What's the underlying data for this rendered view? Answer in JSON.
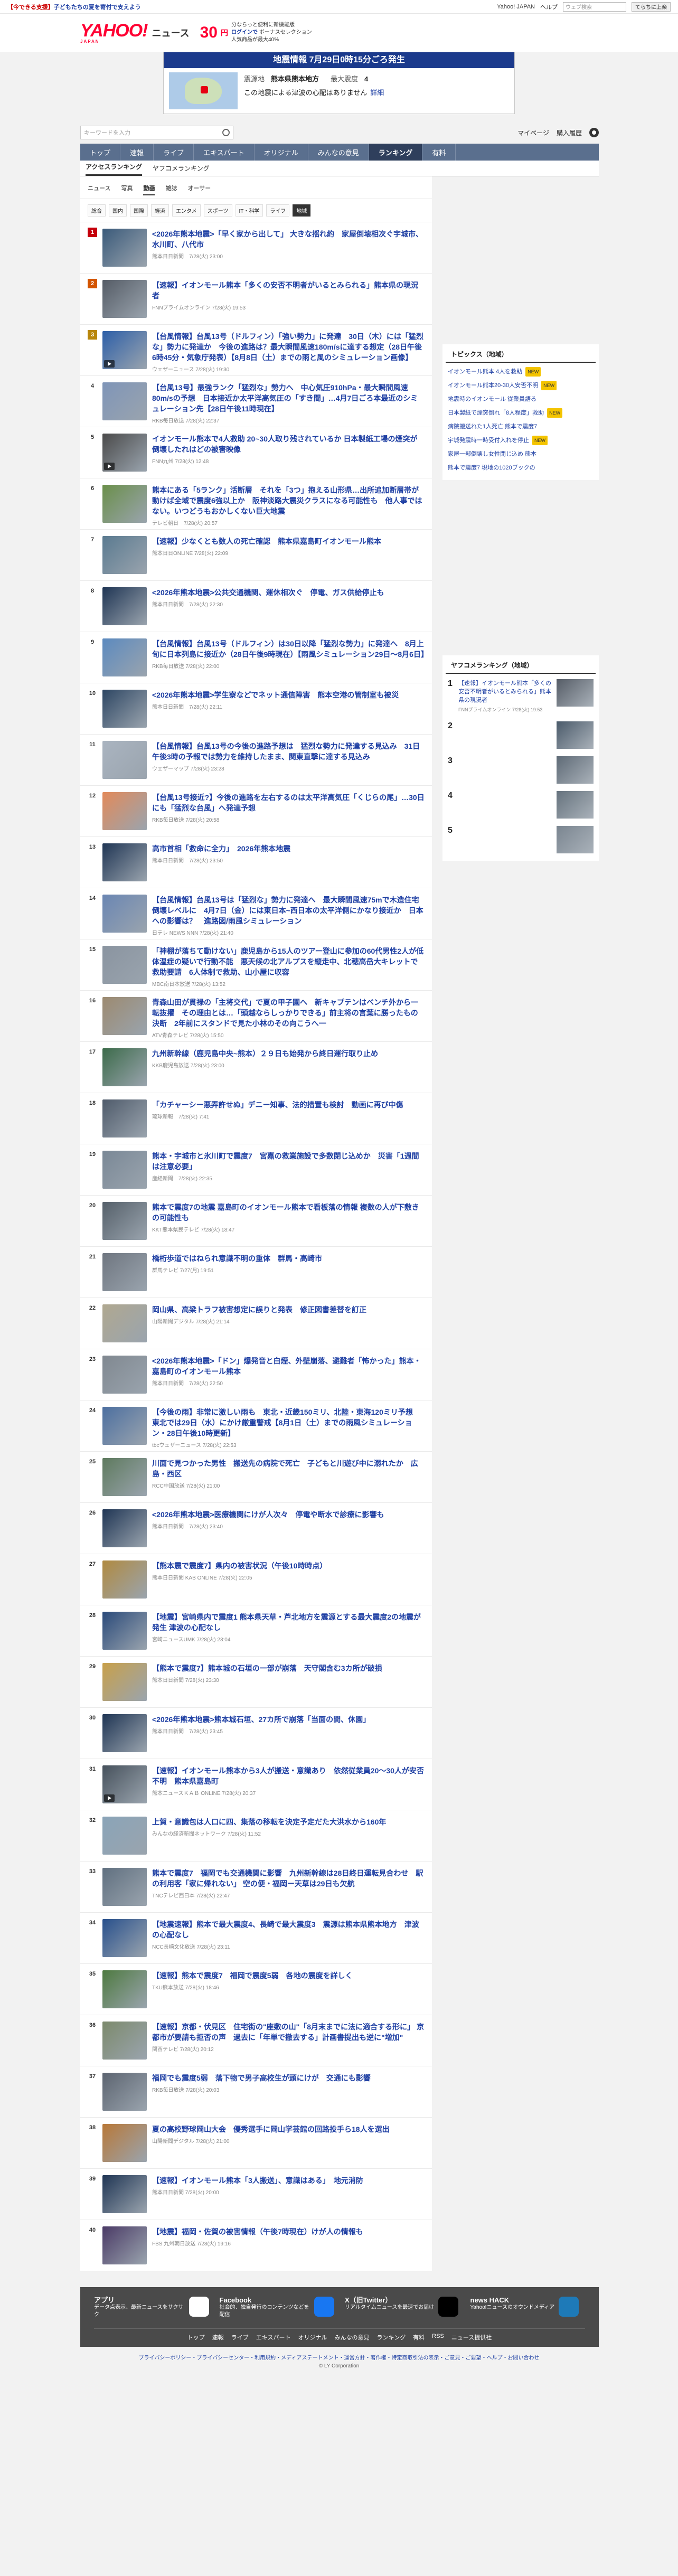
{
  "topbar": {
    "promo_prefix": "【今できる支援】",
    "promo_text": "子どもたちの夏を寄付で支えよう",
    "right_links": [
      "Yahoo! JAPAN",
      "ヘルプ"
    ],
    "search_placeholder": "ウェブ検索",
    "search_button": "てらちに上楽"
  },
  "header": {
    "logo": "YAHOO!",
    "logo_sub": "JAPAN",
    "service": "ニュース",
    "points": "30",
    "points_unit": "円",
    "points_text1": "分ならっと便利に新機能版",
    "points_text2": "ログインで",
    "points_text3": "ボーナスセレクション",
    "points_text4": "人気商品が最大40%"
  },
  "alert": {
    "title": "地震情報 7月29日0時15分ごろ発生",
    "epicenter_label": "震源地",
    "epicenter": "熊本県熊本地方",
    "intensity_label": "最大震度",
    "intensity": "4",
    "note": "この地震による津波の心配はありません",
    "detail": "詳細"
  },
  "search": {
    "placeholder": "キーワードを入力",
    "mypage": "マイページ",
    "register": "購入履歴"
  },
  "nav": {
    "tabs": [
      "トップ",
      "速報",
      "ライブ",
      "エキスパート",
      "オリジナル",
      "みんなの意見",
      "ランキング",
      "有料"
    ],
    "active": 6
  },
  "subtabs": {
    "items": [
      "アクセスランキング",
      "ヤフコメランキング"
    ],
    "active": 0
  },
  "cat1": {
    "items": [
      "ニュース",
      "写真",
      "動画",
      "雑誌",
      "オーサー"
    ],
    "active": 2
  },
  "cat2": {
    "items": [
      "総合",
      "国内",
      "国際",
      "経済",
      "エンタメ",
      "スポーツ",
      "IT・科学",
      "ライフ",
      "地域"
    ],
    "active": 8
  },
  "ranking": [
    {
      "num": "1",
      "title": "<2026年熊本地震>「早く家から出して」 大きな揺れ約　家屋倒壊相次ぐ宇城市、水川町、八代市",
      "meta": "熊本日日新聞　7/28(火) 23:00",
      "thumb": "#3a5a7a"
    },
    {
      "num": "2",
      "title": "【速報】イオンモール熊本「多くの安否不明者がいるとみられる」熊本県の現況者",
      "meta": "FNNプライムオンライン 7/28(火) 19:53",
      "thumb": "#555c66"
    },
    {
      "num": "3",
      "title": "【台風情報】台風13号（ドルフィン）「強い勢力」に発達　30日（木）には「猛烈な」勢力に発達か　今後の進路は？最大瞬間風速180m/sに達する想定（28日午後6時45分・気象庁発表）【8月8日（土）までの雨と風のシミュレーション画像】",
      "meta": "ウェザーニュース 7/28(火) 19:30",
      "thumb": "#2d5fa8",
      "vid": true
    },
    {
      "num": "4",
      "title": "【台風13号】最強ランク「猛烈な」勢力へ　中心気圧910hPa・最大瞬間風速80m/sの予想　日本接近か太平洋高気圧の「すき間」…4月7日ごろ本最近のシミュレーション先【28日午後11時現在】",
      "meta": "RKB毎日放送 7/28(火) 22:37",
      "thumb": "#7f95b8"
    },
    {
      "num": "5",
      "title": "イオンモール熊本で4人救助 20~30人取り残されているか 日本製紙工場の煙突が倒壊したれはどの被害映像",
      "meta": "FNN九州 7/28(火) 12:48",
      "thumb": "#4a4a4a",
      "vid": true
    },
    {
      "num": "6",
      "title": "熊本にある「5ランク」活断層　それを「3つ」抱える山形県…出所追加断層帯が動けば全域で震度6強以上か　阪神淡路大震災クラスになる可能性も　他人事ではない。いつどうもおかしくない巨大地震",
      "meta": "テレビ朝日　7/28(火) 20:57",
      "thumb": "#6a8f4a"
    },
    {
      "num": "7",
      "title": "【速報】少なくとも数人の死亡確認　熊本県嘉島町イオンモール熊本",
      "meta": "熊本日日ONLINE 7/28(火) 22:09",
      "thumb": "#5a7a90"
    },
    {
      "num": "8",
      "title": "<2026年熊本地震>公共交通機関、運休相次ぐ　停電、ガス供給停止も",
      "meta": "熊本日日新聞　7/28(火) 22:30",
      "thumb": "#1f3554"
    },
    {
      "num": "9",
      "title": "【台風情報】台風13号（ドルフィン）は30日以降「猛烈な勢力」に発達へ　8月上旬に日本列島に接近か（28日午後9時現在）【雨風シミュレーション29日～8月6日】",
      "meta": "RKB毎日放送 7/28(火) 22:00",
      "thumb": "#5c8abf"
    },
    {
      "num": "10",
      "title": "<2026年熊本地震>学生寮などでネット通信障害　熊本空港の管制室も被災",
      "meta": "熊本日日新聞　7/28(火) 22:11",
      "thumb": "#2d4663"
    },
    {
      "num": "11",
      "title": "【台風情報】台風13号の今後の進路予想は　猛烈な勢力に発達する見込み　31日午後3時の予報では勢力を維持したまま、関東直撃に達する見込み",
      "meta": "ウェザーマップ 7/28(火) 23:28",
      "thumb": "#aab4c0"
    },
    {
      "num": "12",
      "title": "【台風13号接近?】今後の進路を左右するのは太平洋高気圧「くじらの尾」…30日にも「猛烈な台風」へ発達予想",
      "meta": "RKB毎日放送 7/28(火) 20:58",
      "thumb": "#e28a5a"
    },
    {
      "num": "13",
      "title": "高市首相「救命に全力」　2026年熊本地震",
      "meta": "熊本日日新聞　7/28(火) 23:50",
      "thumb": "#1f3554"
    },
    {
      "num": "14",
      "title": "【台風情報】台風13号は「猛烈な」勢力に発達へ　最大瞬間風速75mで木造住宅倒壊レベルに　4月7日（金）には東日本~西日本の太平洋側にかなり接近か　日本への影響は？　進路図/雨風シミュレーション",
      "meta": "日テレ NEWS NNN 7/28(火) 21:40",
      "thumb": "#6a86b3"
    },
    {
      "num": "15",
      "title": "「神棚が落ちて動けない」鹿児島から15人のツアー登山に参加の60代男性2人が低体温症の疑いで行動不能　悪天候の北アルプスを縦走中、北穂高岳大キレットで救助要請　6人体制で救助、山小屋に収容",
      "meta": "MBC南日本放送 7/28(火) 13:52",
      "thumb": "#8a94a0"
    },
    {
      "num": "16",
      "title": "青森山田が貫禄の「主将交代」で夏の甲子園へ　新キャプテンはベンチ外から一転抜擢　その理由とは…「頭越ならしっかりできる」前主将の言葉に勝ったもの決断　2年前にスタンドで見た小林のその向こうへ一",
      "meta": "ATV青森テレビ 7/28(火) 15:50",
      "thumb": "#9c8a70"
    },
    {
      "num": "17",
      "title": "九州新幹線（鹿児島中央~熊本）２９日も始発から終日運行取り止め",
      "meta": "KKB鹿児島放送 7/28(火) 23:00",
      "thumb": "#3c6b4a"
    },
    {
      "num": "18",
      "title": "「カチャーシー悪弄許せぬ」デニー知事、法的措置も検討　動画に再び中傷",
      "meta": "琉球新報　7/28(火) 7:41",
      "thumb": "#4f5b6b"
    },
    {
      "num": "19",
      "title": "熊本・宇城市と氷川町で震度7　宮嘉の救業施設で多数閉じ込めか　災害「1週間は注意必要」",
      "meta": "産経新聞　7/28(火) 22:35",
      "thumb": "#7a8896"
    },
    {
      "num": "20",
      "title": "熊本で震度7の地震 嘉島町のイオンモール熊本で看板落の情報 複数の人が下敷きの可能性も",
      "meta": "KKT熊本県民テレビ 7/28(火) 18:47",
      "thumb": "#55606a"
    },
    {
      "num": "21",
      "title": "橋桁歩道ではねられ意識不明の重体　群馬・高崎市",
      "meta": "群馬テレビ 7/27(月) 19:51",
      "thumb": "#6f7680"
    },
    {
      "num": "22",
      "title": "岡山県、高梁トラフ被害想定に誤りと発表　修正図書差替を訂正",
      "meta": "山陽新聞デジタル 7/28(火) 21:14",
      "thumb": "#b0a890"
    },
    {
      "num": "23",
      "title": "<2026年熊本地震>「ドン」爆発音と白煙、外壁崩落、避難者「怖かった」熊本・嘉島町のイオンモール熊本",
      "meta": "熊本日日新聞　7/28(火) 22:50",
      "thumb": "#808890"
    },
    {
      "num": "24",
      "title": "【今後の雨】非常に激しい雨も　東北・近畿150ミリ、北陸・東海120ミリ予想　東北では29日（水）にかけ厳重警戒【8月1日（土）までの雨風シミュレーション・28日午後10時更新】",
      "meta": "tbcウェザーニュース 7/28(火) 22:53",
      "thumb": "#4c6fa0"
    },
    {
      "num": "25",
      "title": "川面で見つかった男性　搬送先の病院で死亡　子どもと川遊び中に溺れたか　広島・西区",
      "meta": "RCC中国放送 7/28(火) 21:00",
      "thumb": "#5e7a5e"
    },
    {
      "num": "26",
      "title": "<2026年熊本地震>医療機関にけが人次々　停電や断水で診療に影響も",
      "meta": "熊本日日新聞　7/28(火) 23:40",
      "thumb": "#1f3554"
    },
    {
      "num": "27",
      "title": "【熊本震で震度7】県内の被害状況（午後10時時点）",
      "meta": "熊本日日新聞 KAB ONLINE 7/28(火) 22:05",
      "thumb": "#b08a40"
    },
    {
      "num": "28",
      "title": "【地震】宮崎県内で震度1 熊本県天草・芦北地方を震源とする最大震度2の地震が発生 津波の心配なし",
      "meta": "宮崎ニュースUMK 7/28(火) 23:04",
      "thumb": "#2a4a7a"
    },
    {
      "num": "29",
      "title": "【熊本で震度7】熊本城の石垣の一部が崩落　天守閣含む3カ所が破損",
      "meta": "熊本日日新聞 7/28(火) 23:30",
      "thumb": "#c8a04a"
    },
    {
      "num": "30",
      "title": "<2026年熊本地震>熊本城石垣、27カ所で崩落「当面の間、休園」",
      "meta": "熊本日日新聞　7/28(火) 23:45",
      "thumb": "#1f3554"
    },
    {
      "num": "31",
      "title": "【速報】イオンモール熊本から3人が搬送・意識あり　依然従業員20～30人が安否不明　熊本県嘉島町",
      "meta": "熊本ニュースＫＡＢ ONLINE 7/28(火) 20:37",
      "thumb": "#46515c",
      "vid": true
    },
    {
      "num": "32",
      "title": "上賀・意識包は人口に四、集落の移転を決定予定だた大洪水から160年",
      "meta": "みんなの経済新聞ネットワーク 7/28(火) 11:52",
      "thumb": "#8aa4b8"
    },
    {
      "num": "33",
      "title": "熊本で震度7　福岡でも交通機関に影響　九州新幹線は28日終日運転見合わせ　駅の利用客「家に帰れない」 空の便・福岡ー天草は29日も欠航",
      "meta": "TNCテレビ西日本 7/28(火) 22:47",
      "thumb": "#607080"
    },
    {
      "num": "34",
      "title": "【地震速報】熊本で最大震度4、長崎で最大震度3　震源は熊本県熊本地方　津波の心配なし",
      "meta": "NCC長崎文化放送 7/28(火) 23:11",
      "thumb": "#28508c"
    },
    {
      "num": "35",
      "title": "【速報】熊本で震度7　福岡で震度5弱　各地の震度を詳しく",
      "meta": "TKU熊本放送 7/28(火) 18:46",
      "thumb": "#4e7a40"
    },
    {
      "num": "36",
      "title": "【速報】京都・伏見区　住宅街の\"座敷の山\"「8月末までに法に適合する形に」 京都市が要請も拒否の声　過去に「年単で撤去する」計画書提出も逆に\"増加\"",
      "meta": "関西テレビ 7/28(火) 20:12",
      "thumb": "#7c8a6c"
    },
    {
      "num": "37",
      "title": "福岡でも震度5弱　落下物で男子高校生が頭にけが　交通にも影響",
      "meta": "RKB毎日放送 7/28(火) 20:03",
      "thumb": "#5c6470"
    },
    {
      "num": "38",
      "title": "夏の高校野球岡山大会　優秀選手に岡山学芸館の回路投手ら18人を選出",
      "meta": "山陽新聞デジタル 7/28(火) 21:00",
      "thumb": "#b87838"
    },
    {
      "num": "39",
      "title": "【速報】イオンモール熊本「3人搬送」、意識はある」　地元消防",
      "meta": "熊本日日新聞 7/28(火) 20:00",
      "thumb": "#1f3554"
    },
    {
      "num": "40",
      "title": "【地震】福岡・佐賀の被害情報（午後7時現在）けが人の情報も",
      "meta": "FBS 九州朝日放送 7/28(火) 19:16",
      "thumb": "#4a3a66"
    }
  ],
  "topics": {
    "title": "トピックス（地域）",
    "items": [
      {
        "text": "イオンモール熊本 4人を救助",
        "badge": "NEW"
      },
      {
        "text": "イオンモール熊本20-30人安否不明",
        "badge": "NEW"
      },
      {
        "text": "地震時のイオンモール 従業員語る",
        "badge": ""
      },
      {
        "text": "日本製紙で煙突倒れ「8人程度」救助",
        "badge": "NEW"
      },
      {
        "text": "病院搬送れた1人死亡 熊本で震度7",
        "badge": ""
      },
      {
        "text": "宇城発震時一時受付入れを停止",
        "badge": "NEW"
      },
      {
        "text": "家屋一部倒壊し女性閉じ込め 熊本",
        "badge": ""
      },
      {
        "text": "熊本で震度7 現地の1020ブックの",
        "badge": ""
      }
    ]
  },
  "yrank": {
    "title": "ヤフコメランキング（地域）",
    "items": [
      {
        "n": "1",
        "text": "【速報】イオンモール熊本「多くの安否不明者がいるとみられる」熊本県の現況者",
        "meta": "FNNプライムオンライン 7/28(火) 19:53",
        "thumb": "#555c66"
      },
      {
        "n": "2",
        "text": "",
        "meta": "",
        "thumb": "#4a5a6a"
      },
      {
        "n": "3",
        "text": "",
        "meta": "",
        "thumb": "#5e6a76"
      },
      {
        "n": "4",
        "text": "",
        "meta": "",
        "thumb": "#66737e"
      },
      {
        "n": "5",
        "text": "",
        "meta": "",
        "thumb": "#7a8590"
      }
    ]
  },
  "footer": {
    "apps": [
      {
        "title": "アプリ",
        "desc": "データ点表示、最新ニュースをサクサク",
        "color": "#ffffff"
      },
      {
        "title": "Facebook",
        "desc": "社会的、独自発行のコンテンツなどを配信",
        "color": "#1877f2"
      },
      {
        "title": "X（旧Twitter）",
        "desc": "リアルタイムニュースを最速でお届け",
        "color": "#000000"
      },
      {
        "title": "news HACK",
        "desc": "Yahoo!ニュースのオウンドメディア",
        "color": "#1e7ab8"
      }
    ],
    "links": [
      "トップ",
      "速報",
      "ライブ",
      "エキスパート",
      "オリジナル",
      "みんなの意見",
      "ランキング",
      "有料",
      "RSS",
      "ニュース提供社"
    ],
    "bottom": "プライバシーポリシー・プライバシーセンター・利用規約・メディアステートメント・運営方針・著作権・特定商取引法の表示・ご意見・ご要望・ヘルプ・お問い合わせ",
    "copy": "© LY Corporation"
  }
}
